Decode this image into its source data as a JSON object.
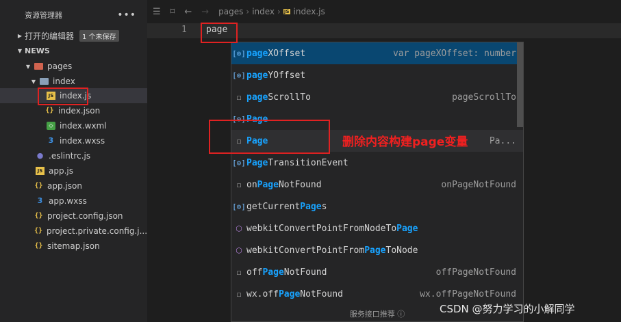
{
  "sidebar": {
    "title": "资源管理器",
    "more_label": "•••",
    "open_editors": {
      "label": "打开的编辑器",
      "badge": "1 个未保存"
    },
    "project": "NEWS",
    "tree": [
      {
        "label": "pages",
        "icon": "folder-icon"
      },
      {
        "label": "index",
        "icon": "folder-open-icon"
      },
      {
        "label": "index.js",
        "icon": "js-file-icon"
      },
      {
        "label": "index.json",
        "icon": "json-file-icon"
      },
      {
        "label": "index.wxml",
        "icon": "wxml-file-icon"
      },
      {
        "label": "index.wxss",
        "icon": "css-file-icon"
      },
      {
        "label": ".eslintrc.js",
        "icon": "eslint-file-icon"
      },
      {
        "label": "app.js",
        "icon": "js-file-icon"
      },
      {
        "label": "app.json",
        "icon": "json-file-icon"
      },
      {
        "label": "app.wxss",
        "icon": "css-file-icon"
      },
      {
        "label": "project.config.json",
        "icon": "json-file-icon"
      },
      {
        "label": "project.private.config.j...",
        "icon": "json-file-icon"
      },
      {
        "label": "sitemap.json",
        "icon": "json-file-icon"
      }
    ]
  },
  "breadcrumb": {
    "parts": [
      "pages",
      "index",
      "index.js"
    ],
    "js_badge": "JS"
  },
  "editor": {
    "line_number": "1",
    "code": "page"
  },
  "suggest": {
    "items": [
      {
        "pre": "",
        "match": "page",
        "post": "XOffset",
        "detail": "var pageXOffset: number",
        "icon": "variable-icon"
      },
      {
        "pre": "",
        "match": "page",
        "post": "YOffset",
        "detail": "",
        "icon": "variable-icon"
      },
      {
        "pre": "",
        "match": "page",
        "post": "ScrollTo",
        "detail": "pageScrollTo",
        "icon": "text-icon"
      },
      {
        "pre": "",
        "match": "Page",
        "post": "",
        "detail": "",
        "icon": "variable-icon"
      },
      {
        "pre": "",
        "match": "Page",
        "post": "",
        "detail": "Pa...",
        "icon": "text-icon"
      },
      {
        "pre": "",
        "match": "Page",
        "post": "TransitionEvent",
        "detail": "",
        "icon": "variable-icon"
      },
      {
        "pre": "on",
        "match": "Page",
        "post": "NotFound",
        "detail": "onPageNotFound",
        "icon": "text-icon"
      },
      {
        "pre": "getCurrent",
        "match": "Page",
        "post": "s",
        "detail": "",
        "icon": "variable-icon"
      },
      {
        "pre": "webkitConvertPointFromNodeTo",
        "match": "Page",
        "post": "",
        "detail": "",
        "icon": "method-icon"
      },
      {
        "pre": "webkitConvertPointFrom",
        "match": "Page",
        "post": "ToNode",
        "detail": "",
        "icon": "method-icon"
      },
      {
        "pre": "off",
        "match": "Page",
        "post": "NotFound",
        "detail": "offPageNotFound",
        "icon": "text-icon"
      },
      {
        "pre": "wx.off",
        "match": "Page",
        "post": "NotFound",
        "detail": "wx.offPageNotFound",
        "icon": "text-icon"
      }
    ],
    "footer": "服务接口推荐 ⓘ"
  },
  "annotation": {
    "text": "删除内容构建page变量"
  },
  "watermark": "CSDN @努力学习的小解同学",
  "colors": {
    "highlight": "#18a3ff",
    "annotation_red": "#e02222",
    "active_row": "#094771"
  }
}
